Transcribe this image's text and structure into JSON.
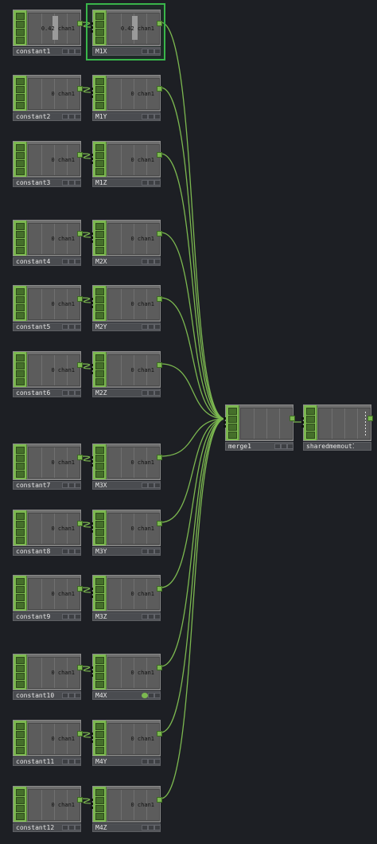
{
  "network": {
    "colors": {
      "background": "#1d1f24",
      "wire": "#7cb850",
      "node_active_strip": "#7cb850",
      "selection": "#39b54a"
    },
    "constants": [
      {
        "name": "constant1",
        "value": "0.42",
        "channel": "chan1"
      },
      {
        "name": "constant2",
        "value": "0",
        "channel": "chan1"
      },
      {
        "name": "constant3",
        "value": "0",
        "channel": "chan1"
      },
      {
        "name": "constant4",
        "value": "0",
        "channel": "chan1"
      },
      {
        "name": "constant5",
        "value": "0",
        "channel": "chan1"
      },
      {
        "name": "constant6",
        "value": "0",
        "channel": "chan1"
      },
      {
        "name": "constant7",
        "value": "0",
        "channel": "chan1"
      },
      {
        "name": "constant8",
        "value": "0",
        "channel": "chan1"
      },
      {
        "name": "constant9",
        "value": "0",
        "channel": "chan1"
      },
      {
        "name": "constant10",
        "value": "0",
        "channel": "chan1"
      },
      {
        "name": "constant11",
        "value": "0",
        "channel": "chan1"
      },
      {
        "name": "constant12",
        "value": "0",
        "channel": "chan1"
      }
    ],
    "renames": [
      {
        "name": "M1X",
        "value": "0.42",
        "channel": "chan1"
      },
      {
        "name": "M1Y",
        "value": "0",
        "channel": "chan1"
      },
      {
        "name": "M1Z",
        "value": "0",
        "channel": "chan1"
      },
      {
        "name": "M2X",
        "value": "0",
        "channel": "chan1"
      },
      {
        "name": "M2Y",
        "value": "0",
        "channel": "chan1"
      },
      {
        "name": "M2Z",
        "value": "0",
        "channel": "chan1"
      },
      {
        "name": "M3X",
        "value": "0",
        "channel": "chan1"
      },
      {
        "name": "M3Y",
        "value": "0",
        "channel": "chan1"
      },
      {
        "name": "M3Z",
        "value": "0",
        "channel": "chan1"
      },
      {
        "name": "M4X",
        "value": "0",
        "channel": "chan1"
      },
      {
        "name": "M4Y",
        "value": "0",
        "channel": "chan1"
      },
      {
        "name": "M4Z",
        "value": "0",
        "channel": "chan1"
      }
    ],
    "merge": {
      "name": "merge1"
    },
    "output": {
      "name": "sharedmemout1"
    }
  }
}
